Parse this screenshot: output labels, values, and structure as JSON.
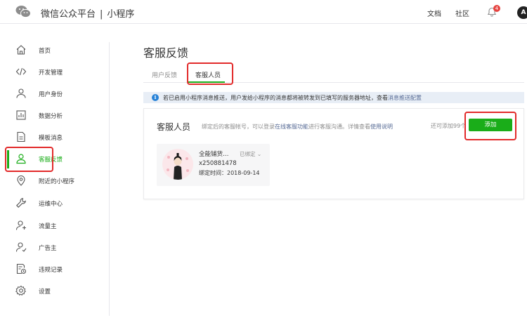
{
  "header": {
    "brand": "微信公众平台",
    "separator": "|",
    "product": "小程序",
    "links": {
      "docs": "文档",
      "community": "社区"
    },
    "notification_count": "4",
    "avatar_letter": "A"
  },
  "sidebar": {
    "items": [
      {
        "label": "首页",
        "icon": "home-icon"
      },
      {
        "label": "开发管理",
        "icon": "code-icon"
      },
      {
        "label": "用户身份",
        "icon": "user-icon"
      },
      {
        "label": "数据分析",
        "icon": "chart-icon"
      },
      {
        "label": "模板消息",
        "icon": "template-icon"
      },
      {
        "label": "客服反馈",
        "icon": "customer-service-icon",
        "active": true
      },
      {
        "label": "附近的小程序",
        "icon": "location-icon"
      },
      {
        "label": "运维中心",
        "icon": "wrench-icon"
      },
      {
        "label": "流量主",
        "icon": "traffic-user-icon"
      },
      {
        "label": "广告主",
        "icon": "advertiser-icon"
      },
      {
        "label": "违规记录",
        "icon": "violation-record-icon"
      },
      {
        "label": "设置",
        "icon": "settings-icon"
      }
    ]
  },
  "main": {
    "title": "客服反馈",
    "tabs": [
      {
        "label": "用户反馈",
        "active": false
      },
      {
        "label": "客服人员",
        "active": true
      }
    ],
    "notice": {
      "text": "若已启用小程序消息推送，用户发给小程序的消息都将被转发到已填写的服务器地址，查看",
      "link": "消息推送配置"
    },
    "card": {
      "title": "客服人员",
      "desc_part1": "绑定后的客服帐号，可以登录",
      "desc_link1": "在线客服功能",
      "desc_part2": "进行客服沟通。详情查看",
      "desc_link2": "使用说明",
      "remaining": "还可添加99个",
      "add_button": "添加",
      "staff": {
        "name": "全能铺货…",
        "status": "已绑定",
        "account": "x250881478",
        "bind_label": "绑定时间：",
        "bind_date": "2018-09-14"
      }
    }
  },
  "colors": {
    "accent": "#1aad19",
    "link": "#576b95",
    "highlight": "#e22a2a",
    "badge": "#e64340",
    "info": "#2782d7"
  }
}
